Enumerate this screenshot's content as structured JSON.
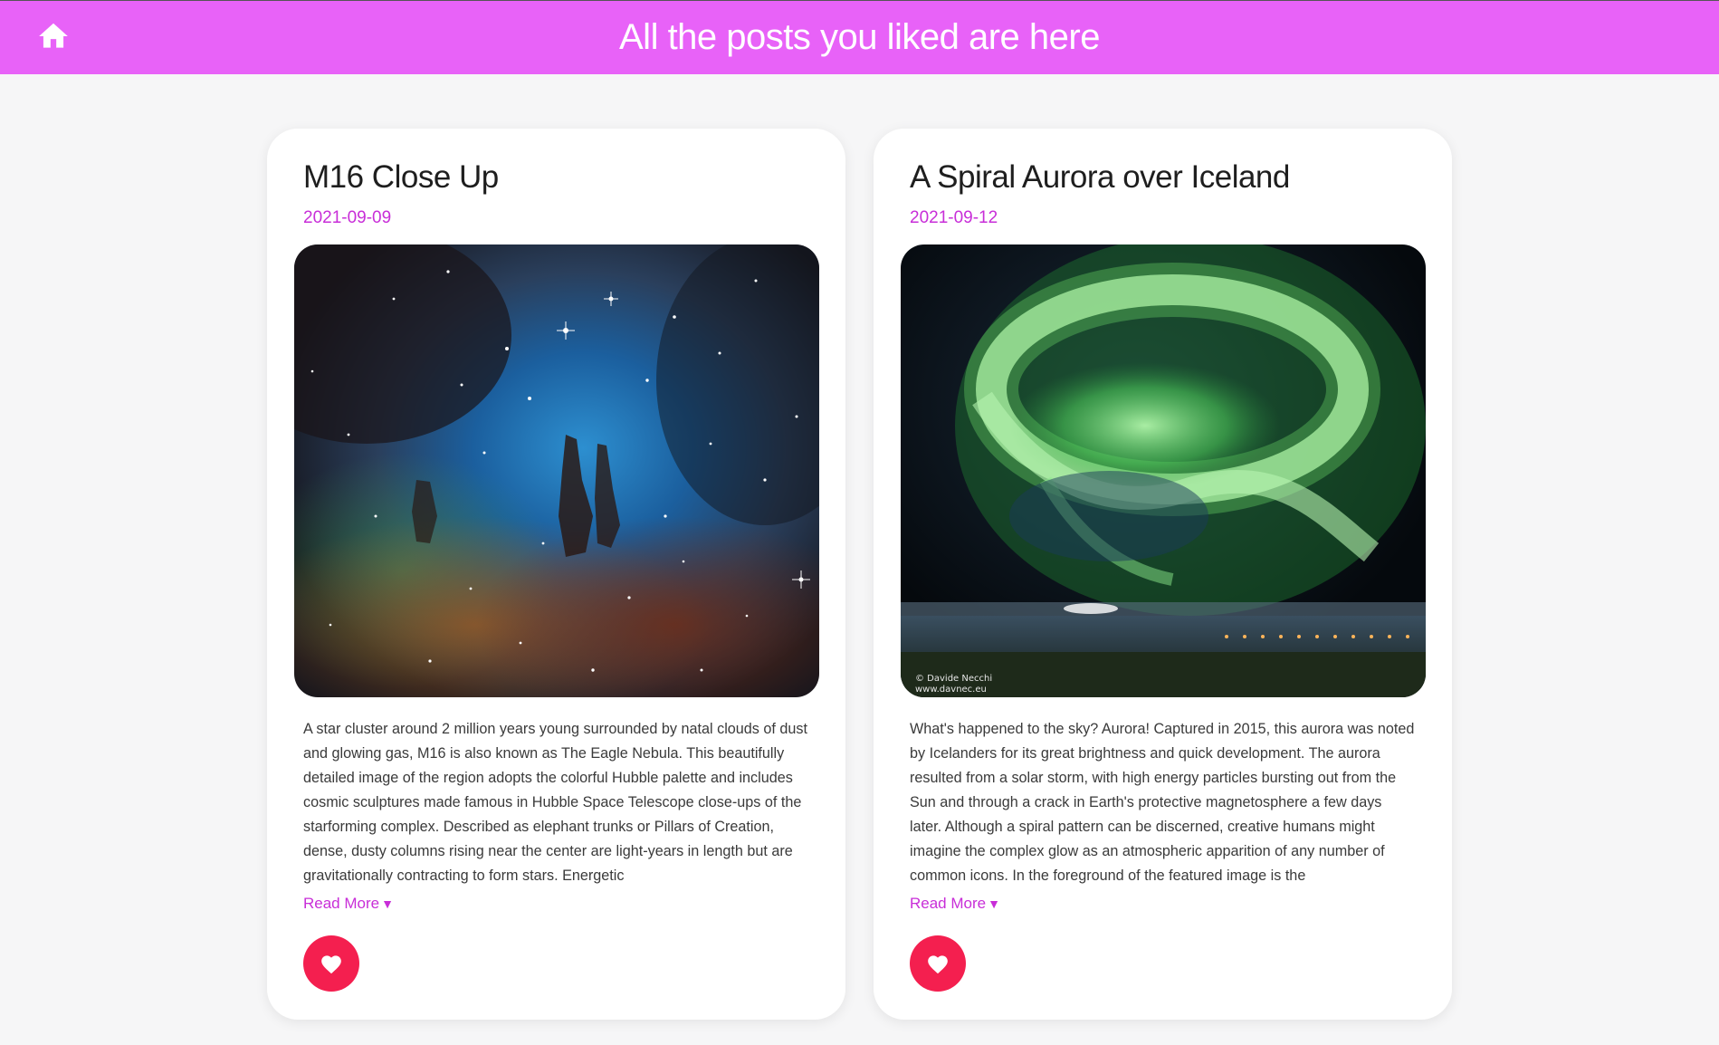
{
  "header": {
    "title": "All the posts you liked are here",
    "home_icon": "home-icon",
    "background_color": "#e862f8"
  },
  "posts": [
    {
      "title": "M16 Close Up",
      "date": "2021-09-09",
      "description": "A star cluster around 2 million years young surrounded by natal clouds of dust and glowing gas, M16 is also known as The Eagle Nebula. This beautifully detailed image of the region adopts the colorful Hubble palette and includes cosmic sculptures made famous in Hubble Space Telescope close-ups of the starforming complex. Described as elephant trunks or Pillars of Creation, dense, dusty columns rising near the center are light-years in length but are gravitationally contracting to form stars. Energetic",
      "read_more": "Read More",
      "like_icon": "heart-icon",
      "liked": true
    },
    {
      "title": "A Spiral Aurora over Iceland",
      "date": "2021-09-12",
      "description": "What's happened to the sky? Aurora! Captured in 2015, this aurora was noted by Icelanders for its great brightness and quick development. The aurora resulted from a solar storm, with high energy particles bursting out from the Sun and through a crack in Earth's protective magnetosphere a few days later. Although a spiral pattern can be discerned, creative humans might imagine the complex glow as an atmospheric apparition of any number of common icons. In the foreground of the featured image is the",
      "read_more": "Read More",
      "like_icon": "heart-icon",
      "liked": true,
      "image_credit": "© Davide Necchi",
      "image_credit_url": "www.davnec.eu"
    }
  ],
  "colors": {
    "accent": "#c82ed8",
    "like": "#f41f4f",
    "page_background": "#f6f6f7"
  }
}
